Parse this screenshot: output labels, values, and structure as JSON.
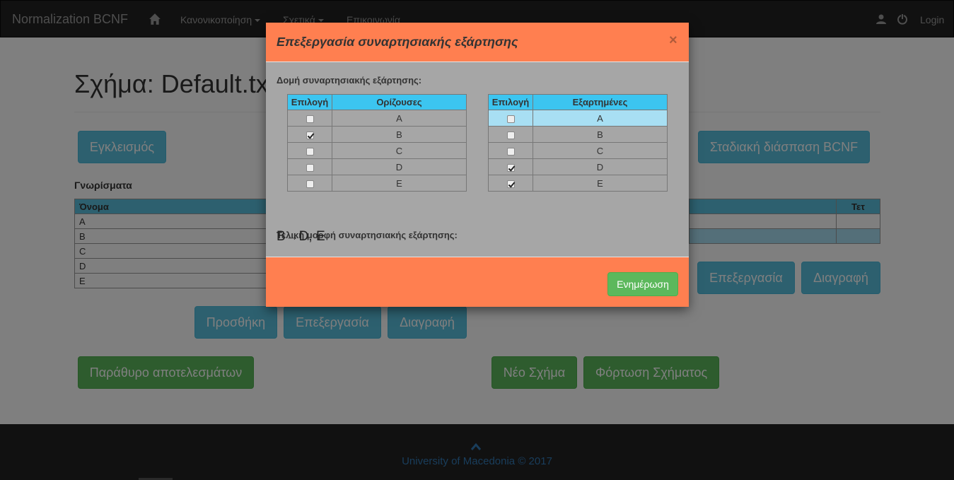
{
  "navbar": {
    "brand": "Normalization BCNF",
    "menu1": "Κανονικοποίηση",
    "menu2": "Σχετικά",
    "menu3": "Επικοινωνία",
    "login": "Login"
  },
  "main": {
    "title": "Σχήμα: Default.txt",
    "closure_button": "Εγκλεισμός",
    "bcnf_button": "Σταδιακή διάσπαση BCNF",
    "attributes_label": "Γνωρίσματα",
    "attr_table": {
      "headers": [
        "Όνομα"
      ],
      "rows": [
        "A",
        "B",
        "C",
        "D",
        "E"
      ]
    },
    "fd_table_header_right": "Τετ",
    "attr_buttons": {
      "add": "Προσθήκη",
      "edit": "Επεξεργασία",
      "delete": "Διαγραφή"
    },
    "fd_buttons": {
      "edit": "Επεξεργασία",
      "delete": "Διαγραφή"
    },
    "results_button": "Παράθυρο αποτελεσμάτων",
    "new_schema_button": "Νέο Σχήμα",
    "load_schema_button": "Φόρτωση Σχήματος"
  },
  "footer": {
    "text": "University of Macedonia © 2017"
  },
  "modal": {
    "title": "Επεξεργασία συναρτησιακής εξάρτησης",
    "close": "×",
    "structure_label": "Δομή συναρτησιακής εξάρτησης:",
    "left_table": {
      "col1": "Επιλογή",
      "col2": "Ορίζουσες",
      "rows": [
        {
          "attr": "A",
          "checked": false
        },
        {
          "attr": "B",
          "checked": true
        },
        {
          "attr": "C",
          "checked": false
        },
        {
          "attr": "D",
          "checked": false
        },
        {
          "attr": "E",
          "checked": false
        }
      ]
    },
    "right_table": {
      "col1": "Επιλογή",
      "col2": "Εξαρτημένες",
      "rows": [
        {
          "attr": "A",
          "checked": false
        },
        {
          "attr": "B",
          "checked": false
        },
        {
          "attr": "C",
          "checked": false
        },
        {
          "attr": "D",
          "checked": true
        },
        {
          "attr": "E",
          "checked": true
        }
      ]
    },
    "final_label": "Τελική μορφή συναρτησιακής εξάρτησης:",
    "final_value": "B→D, E",
    "update_button": "Ενημέρωση"
  },
  "colors": {
    "navbar_bg": "#222222",
    "modal_header": "#ff7f50",
    "info": "#5bc0de",
    "success": "#5cb85c"
  }
}
